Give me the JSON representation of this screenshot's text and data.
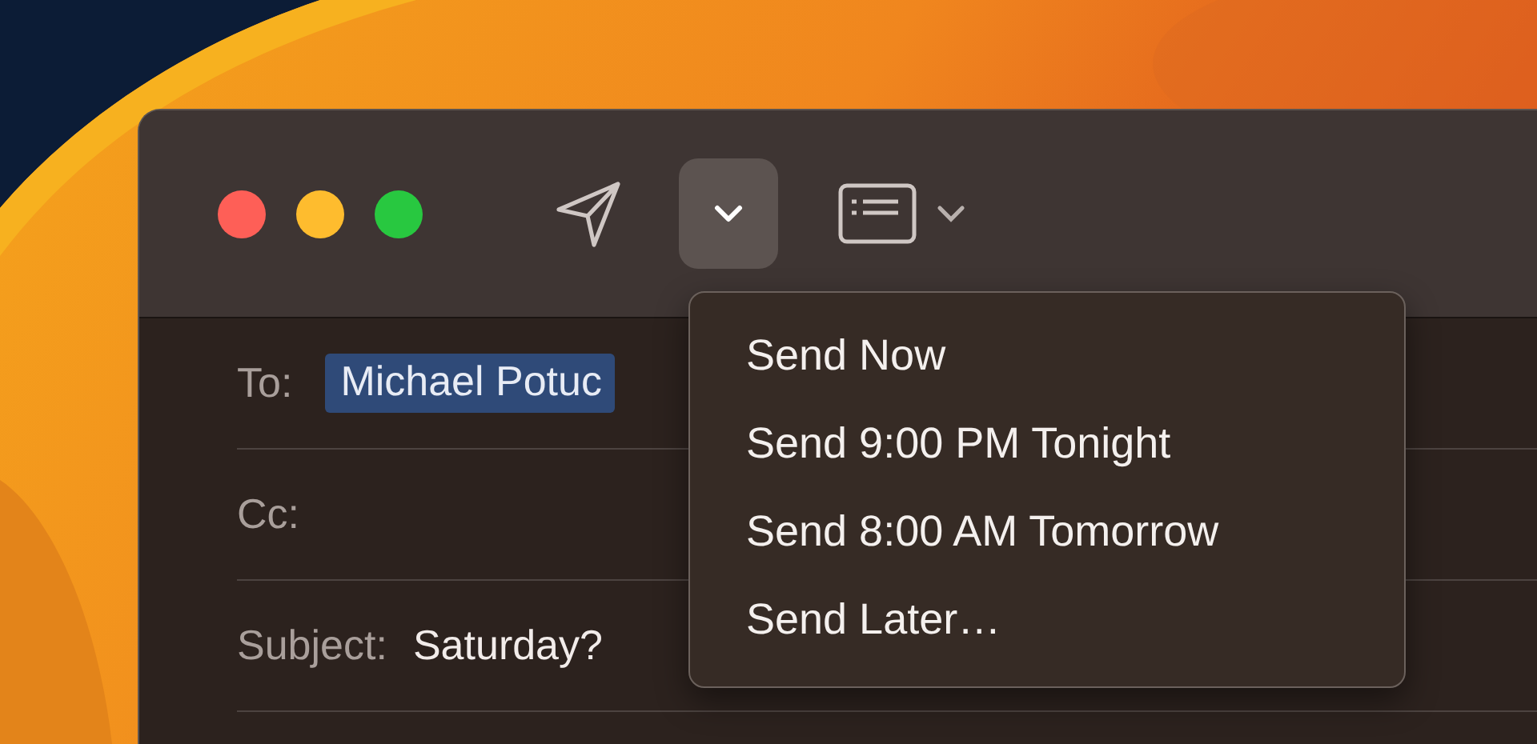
{
  "window": {
    "toolbar": {
      "send_options_button": {
        "expanded": true
      }
    },
    "fields": [
      {
        "label": "To:",
        "kind": "recipient",
        "value": "Michael Potuc",
        "selected": true
      },
      {
        "label": "Cc:"
      },
      {
        "label": "Subject:",
        "kind": "text",
        "value": "Saturday?"
      }
    ]
  },
  "send_menu": {
    "items": [
      "Send Now",
      "Send 9:00 PM Tonight",
      "Send 8:00 AM Tomorrow",
      "Send Later…"
    ]
  }
}
